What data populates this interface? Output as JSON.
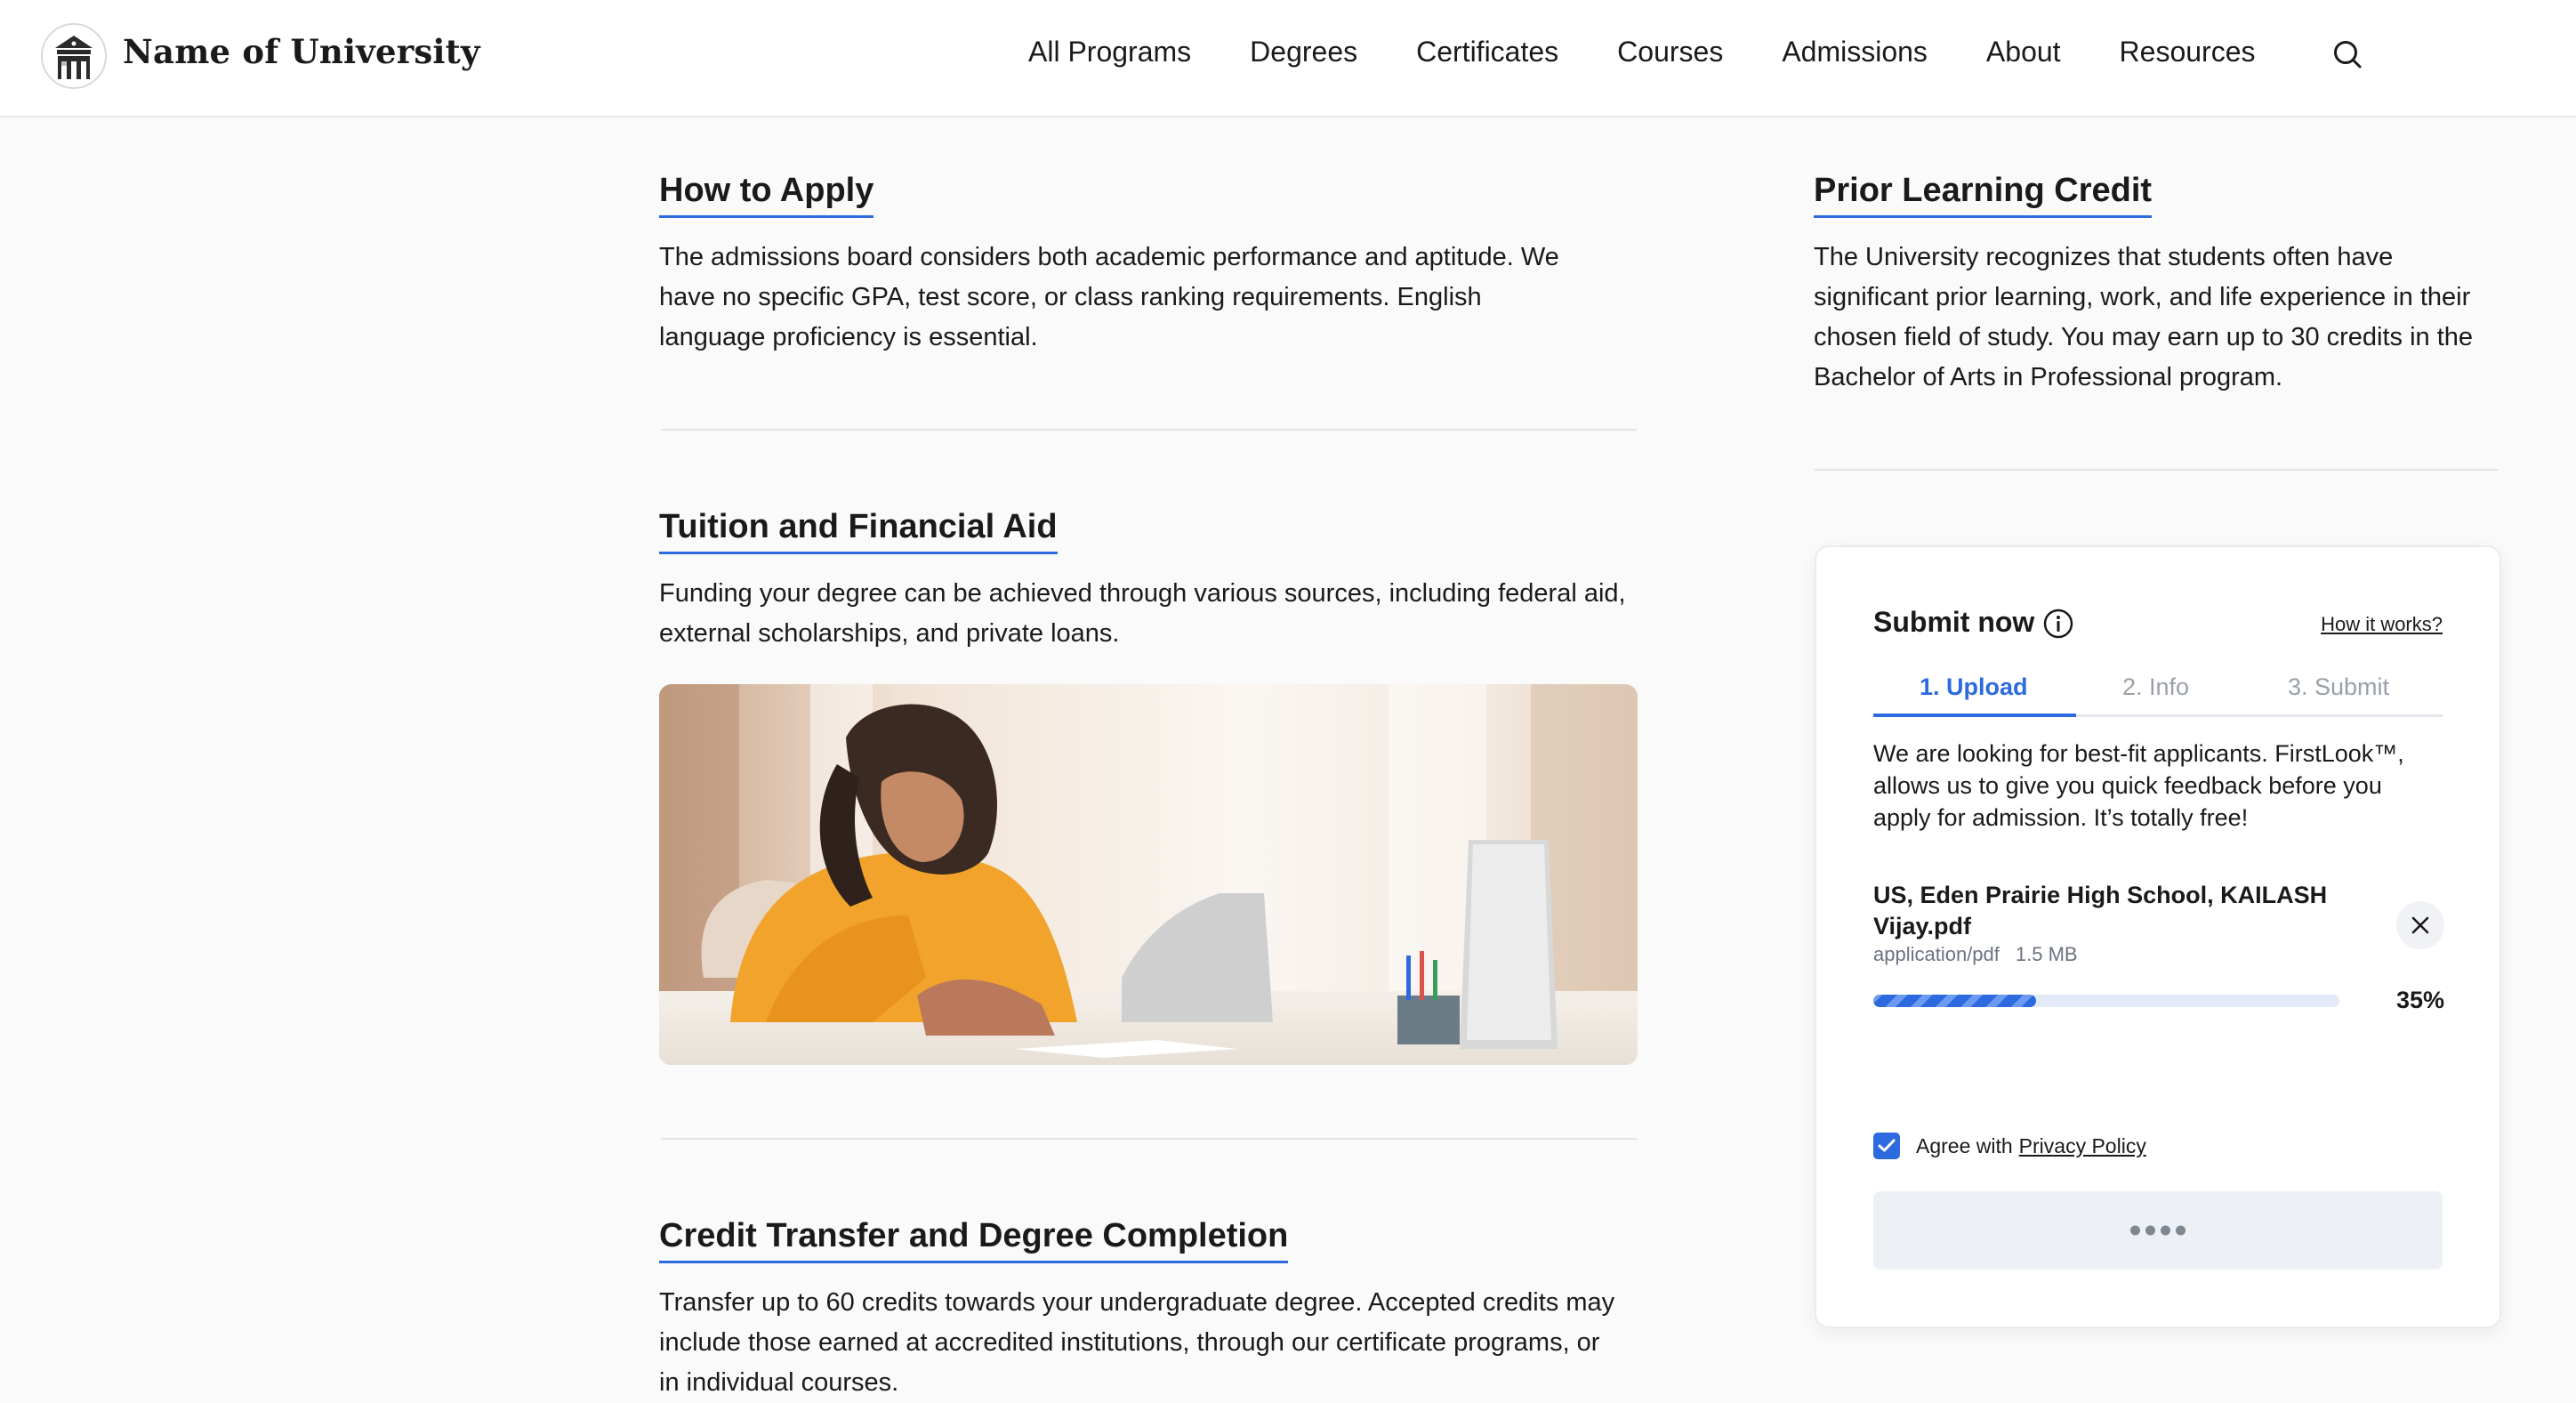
{
  "header": {
    "brand": "Name of University",
    "nav": [
      "All Programs",
      "Degrees",
      "Certificates",
      "Courses",
      "Admissions",
      "About",
      "Resources"
    ]
  },
  "sections": {
    "apply": {
      "title": "How to Apply",
      "text": "The admissions board considers both academic performance and aptitude. We have no specific GPA, test score, or class ranking requirements. English language proficiency is essential."
    },
    "tuition": {
      "title": "Tuition and Financial Aid",
      "text": "Funding your degree can be achieved through various sources, including federal aid, external scholarships, and private loans."
    },
    "transfer": {
      "title": "Credit Transfer and Degree Completion",
      "text": "Transfer up to 60 credits towards your undergraduate degree. Accepted credits may include those earned at accredited institutions, through our certificate programs, or in individual courses."
    },
    "prior": {
      "title": "Prior Learning Credit",
      "text": "The University recognizes that students often have significant prior learning, work, and life experience in their chosen field of study. You may earn up to 30 credits in the Bachelor of Arts in Professional program."
    }
  },
  "card": {
    "title": "Submit now",
    "how_link": "How it works?",
    "steps": [
      "1. Upload",
      "2. Info",
      "3. Submit"
    ],
    "active_step": 0,
    "text": "We are looking for best-fit applicants. FirstLook™, allows us to give you quick feedback before you apply for admission. It’s totally free!",
    "file": {
      "name": "US, Eden Prairie High School, KAILASH Vijay.pdf",
      "type": "application/pdf",
      "size": "1.5 MB",
      "progress": 0.35,
      "progress_label": "35%"
    },
    "agree_text": "Agree with",
    "agree_link": "Privacy Policy",
    "agree_checked": true
  },
  "colors": {
    "accent": "#2d6adf"
  }
}
